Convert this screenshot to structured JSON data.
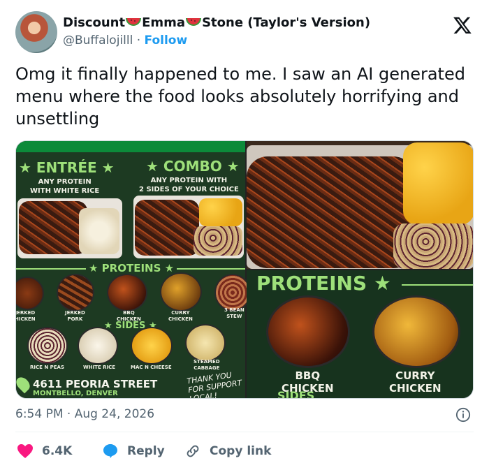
{
  "author": {
    "display_name_parts": [
      "Discount",
      "Emma",
      "Stone (Taylor's Version)"
    ],
    "handle": "@Buffalojilll",
    "separator": "·",
    "follow_label": "Follow"
  },
  "tweet": {
    "text": "Omg it finally happened to me. I saw an AI generated menu where the food looks absolutely horrifying and unsettling",
    "timestamp": "6:54 PM · Aug 24, 2026"
  },
  "media": {
    "left": {
      "entree_title": "★ ENTRÉE ★",
      "entree_sub": "ANY PROTEIN\nWITH WHITE RICE",
      "combo_title": "★ COMBO ★",
      "combo_sub": "ANY PROTEIN WITH\n2 SIDES OF YOUR CHOICE",
      "proteins_title": "★ PROTEINS ★",
      "proteins": [
        "JERKED\nHICKEN",
        "JERKED\nPORK",
        "BBQ\nCHICKEN",
        "CURRY\nCHICKEN",
        "3 BEAN\nSTEW"
      ],
      "sides_title": "★ SIDES ★",
      "sides": [
        "RICE N PEAS",
        "WHITE RICE",
        "MAC N CHEESE",
        "STEAMED\nCABBAGE"
      ],
      "address": "4611 PEORIA STREET",
      "city": "MONTBELLO, DENVER",
      "thanks": "THANK YOU\nFOR SUPPORT\nLOCAL!"
    },
    "right": {
      "proteins_title": "PROTEINS ★",
      "items": [
        "BBQ\nCHICKEN",
        "CURRY\nCHICKEN"
      ],
      "sides_partial": "SIDES"
    }
  },
  "engagement": {
    "likes": "6.4K",
    "reply_label": "Reply",
    "copy_link_label": "Copy link"
  },
  "colors": {
    "accent": "#1d9bf0",
    "like": "#f91880",
    "muted": "#536471",
    "menu_green": "#9ee07a"
  }
}
